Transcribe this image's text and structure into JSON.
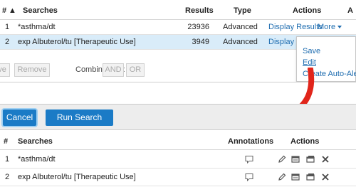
{
  "top": {
    "headers": {
      "num": "#",
      "sort": "▲",
      "searches": "Searches",
      "results": "Results",
      "type": "Type",
      "actions": "Actions",
      "cut": "A"
    },
    "rows": [
      {
        "num": "1",
        "search": "*asthma/dt",
        "results": "23936",
        "type": "Advanced",
        "display": "Display Results",
        "more": "More"
      },
      {
        "num": "2",
        "search": "exp Albuterol/tu [Therapeutic Use]",
        "results": "3949",
        "type": "Advanced",
        "display": "Display R"
      }
    ],
    "buttons": {
      "cut_left": "ve",
      "remove": "Remove",
      "combine": "Combine with:",
      "and": "AND",
      "or": "OR"
    },
    "more_menu": {
      "save": "Save",
      "edit": "Edit",
      "alert": "Create Auto-Alert"
    }
  },
  "bottom": {
    "cancel": "Cancel",
    "run": "Run Search",
    "headers": {
      "num": "#",
      "searches": "Searches",
      "annotations": "Annotations",
      "actions": "Actions"
    },
    "rows": [
      {
        "num": "1",
        "search": "*asthma/dt"
      },
      {
        "num": "2",
        "search": "exp Albuterol/tu [Therapeutic Use]"
      }
    ]
  },
  "colors": {
    "accent": "#1b7bc6",
    "link": "#1f6db0",
    "arrow": "#e1251b",
    "selected_row": "#d9ecf9"
  }
}
